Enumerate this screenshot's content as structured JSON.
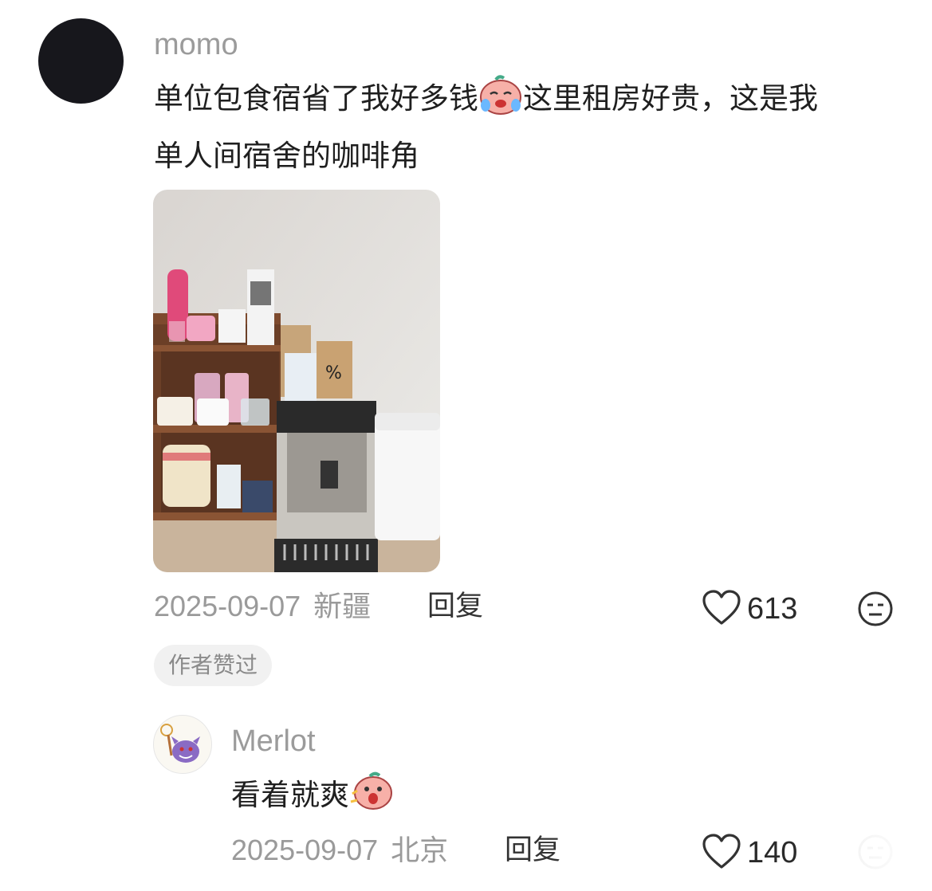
{
  "comments": [
    {
      "username": "momo",
      "text_line1_part1": "单位包食宿省了我好多钱",
      "text_line1_part2": "这里租房好贵，这是我",
      "text_line2": "单人间宿舍的咖啡角",
      "date": "2025-09-07",
      "location": "新疆",
      "reply_label": "回复",
      "likes": "613",
      "author_liked_tag": "作者赞过",
      "emoji": "crying-peach-emoji"
    },
    {
      "username": "Merlot",
      "text": "看着就爽",
      "date": "2025-09-07",
      "location": "北京",
      "reply_label": "回复",
      "likes": "140",
      "emoji": "shocked-peach-emoji"
    }
  ],
  "colors": {
    "meta_gray": "#9a9a9a",
    "emoji_peach": "#f4a7a0",
    "tag_bg": "#f1f1f1"
  }
}
